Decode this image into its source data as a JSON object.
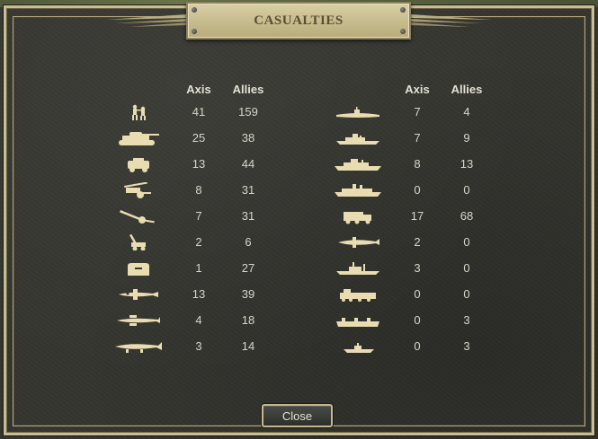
{
  "dialog": {
    "title": "CASUALTIES",
    "close_label": "Close"
  },
  "headers": {
    "left_axis": "Axis",
    "left_allies": "Allies",
    "right_axis": "Axis",
    "right_allies": "Allies"
  },
  "left_rows": [
    {
      "icon": "infantry-icon",
      "axis": "41",
      "allies": "159"
    },
    {
      "icon": "tank-icon",
      "axis": "25",
      "allies": "38"
    },
    {
      "icon": "armored-car-icon",
      "axis": "13",
      "allies": "44"
    },
    {
      "icon": "anti-tank-gun-icon",
      "axis": "8",
      "allies": "31"
    },
    {
      "icon": "artillery-icon",
      "axis": "7",
      "allies": "31"
    },
    {
      "icon": "anti-air-gun-icon",
      "axis": "2",
      "allies": "6"
    },
    {
      "icon": "fortification-icon",
      "axis": "1",
      "allies": "27"
    },
    {
      "icon": "fighter-icon",
      "axis": "13",
      "allies": "39"
    },
    {
      "icon": "tactical-bomber-icon",
      "axis": "4",
      "allies": "18"
    },
    {
      "icon": "strategic-bomber-icon",
      "axis": "3",
      "allies": "14"
    }
  ],
  "right_rows": [
    {
      "icon": "submarine-icon",
      "axis": "7",
      "allies": "4"
    },
    {
      "icon": "destroyer-icon",
      "axis": "7",
      "allies": "9"
    },
    {
      "icon": "cruiser-icon",
      "axis": "8",
      "allies": "13"
    },
    {
      "icon": "battleship-icon",
      "axis": "0",
      "allies": "0"
    },
    {
      "icon": "truck-icon",
      "axis": "17",
      "allies": "68"
    },
    {
      "icon": "transport-plane-icon",
      "axis": "2",
      "allies": "0"
    },
    {
      "icon": "transport-ship-icon",
      "axis": "3",
      "allies": "0"
    },
    {
      "icon": "train-icon",
      "axis": "0",
      "allies": "0"
    },
    {
      "icon": "landing-craft-icon",
      "axis": "0",
      "allies": "3"
    },
    {
      "icon": "patrol-boat-icon",
      "axis": "0",
      "allies": "3"
    }
  ],
  "colors": {
    "icon": "#e8dcb0",
    "frame": "#c9bd93",
    "text": "#d8d5c8"
  }
}
